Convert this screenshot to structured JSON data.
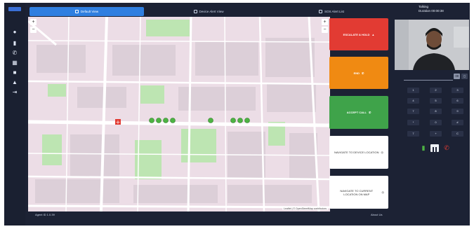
{
  "tabs": [
    {
      "label": "Default View"
    },
    {
      "label": "Device Alert View"
    },
    {
      "label": "SOS Alert List"
    }
  ],
  "call": {
    "state": "Talking",
    "duration": "Duration 00:00:38"
  },
  "actions": {
    "escalate": "ESCALATE & HOLD",
    "end": "END",
    "accept": "ACCEPT CALL",
    "nav_to_device": "NAVIGATE TO DEVICE LOCATION",
    "nav_to_current": "NAVIGATE TO CURRENT LOCATION ON MAP"
  },
  "keypad": {
    "keys": [
      "1",
      "2",
      "3",
      "4",
      "5",
      "6",
      "7",
      "8",
      "9",
      "*",
      "0",
      "#",
      "7",
      "+",
      "C"
    ]
  },
  "map": {
    "attribution": "Leaflet | © OpenStreetMap contributors",
    "zoom_in": "+",
    "zoom_out": "−"
  },
  "status": {
    "left": "Agent ID 1.0.39",
    "right": "About Us"
  },
  "colors": {
    "accent": "#2f7fe0",
    "escalate": "#e23b33",
    "end": "#f08a12",
    "accept": "#3fa34a",
    "pin": "#4db343",
    "map_bg": "#ecdde6",
    "park": "#bde5b2"
  },
  "icons": {
    "sidebar": [
      "chat-icon",
      "bar-chart-icon",
      "phone-icon",
      "grid-icon",
      "folder-icon",
      "lock-icon",
      "logout-icon"
    ]
  }
}
